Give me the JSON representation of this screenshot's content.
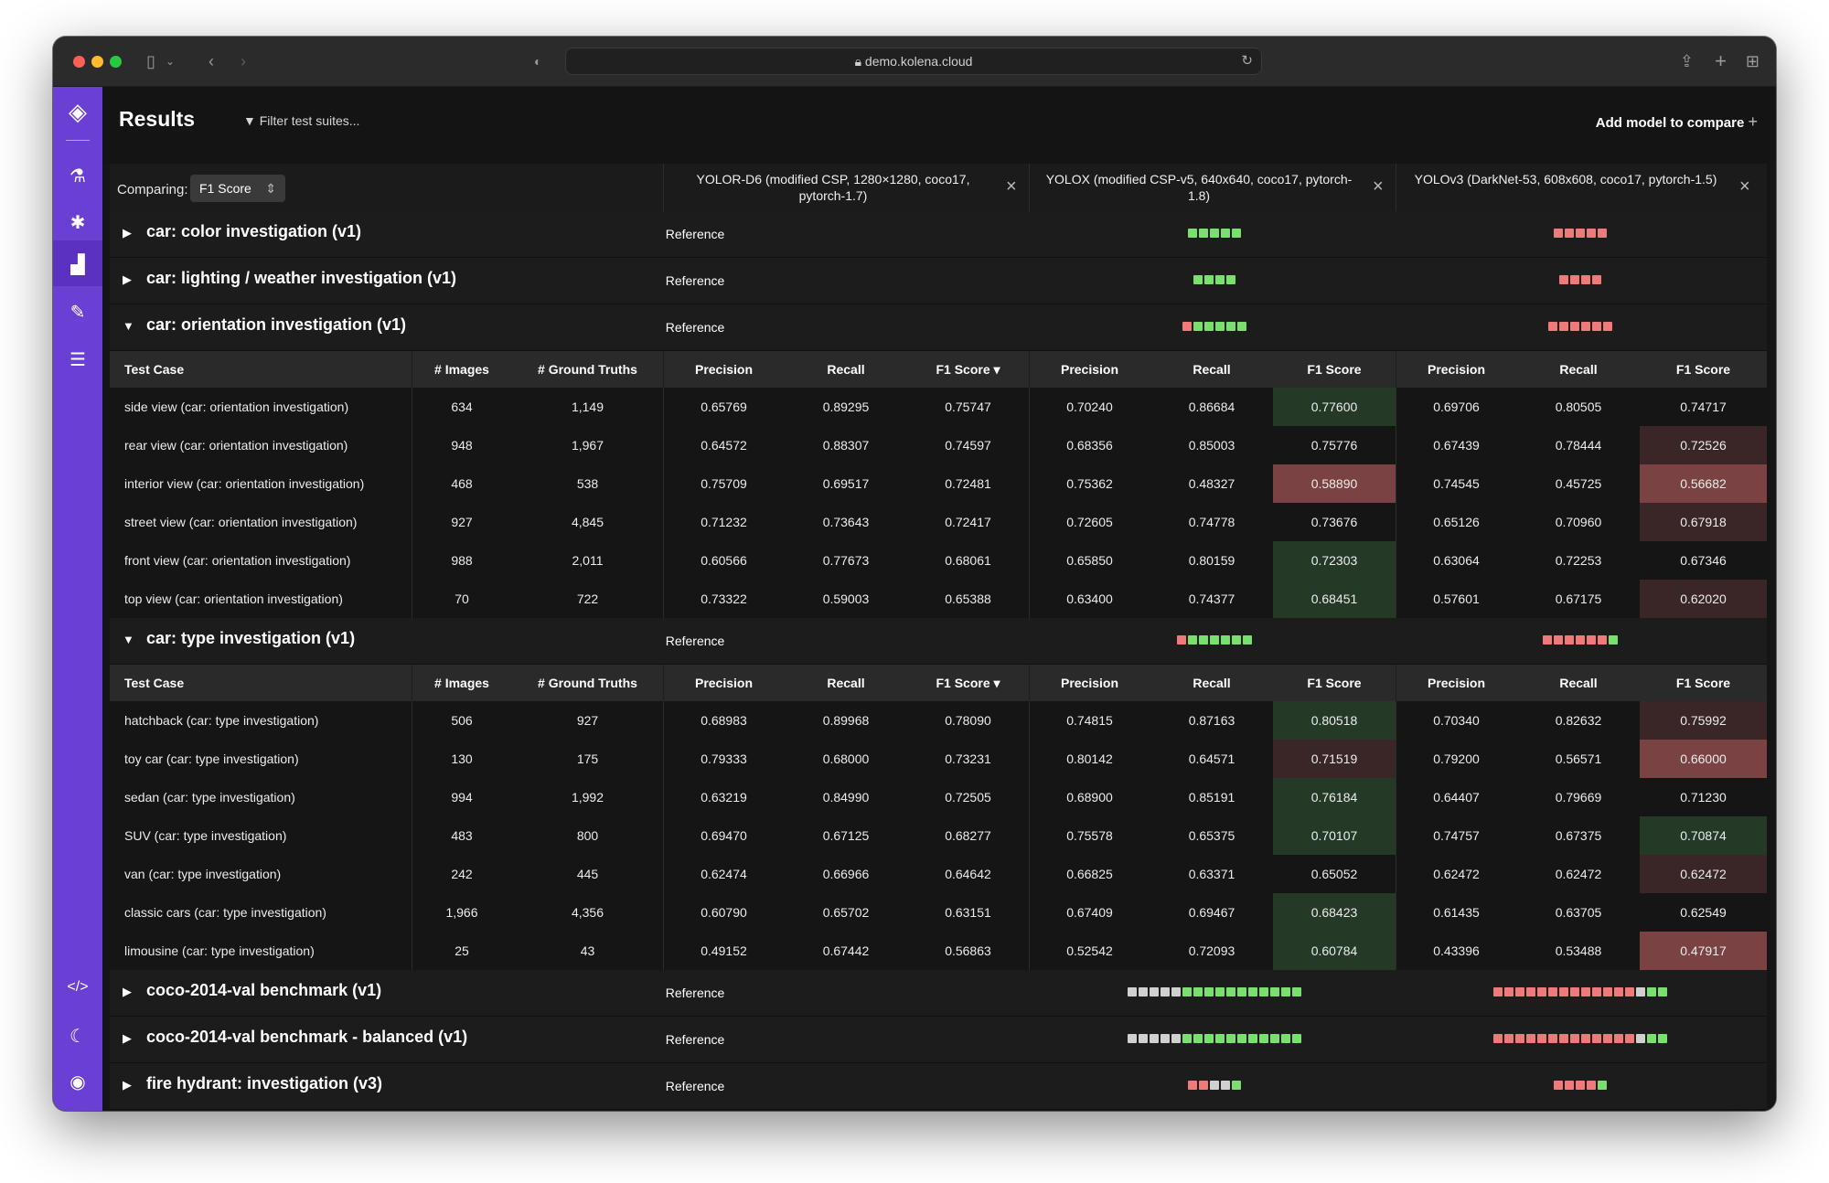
{
  "browser": {
    "url": "demo.kolena.cloud"
  },
  "app": {
    "title": "Results",
    "filter_label": "Filter test suites...",
    "add_model_label": "Add model to compare",
    "comparing_label": "Comparing:",
    "comparing_value": "F1 Score"
  },
  "models": [
    {
      "name": "YOLOR-D6 (modified CSP, 1280×1280, coco17, pytorch-1.7)"
    },
    {
      "name": "YOLOX (modified CSP-v5, 640x640, coco17, pytorch-1.8)"
    },
    {
      "name": "YOLOv3 (DarkNet-53, 608x608, coco17, pytorch-1.5)"
    }
  ],
  "columns": {
    "test_case": "Test Case",
    "images": "# Images",
    "ground_truths": "# Ground Truths",
    "precision": "Precision",
    "recall": "Recall",
    "f1": "F1 Score",
    "f1_sorted": "F1 Score ▾"
  },
  "reference_label": "Reference",
  "colors": {
    "green": "#79e06d",
    "red": "#f07a7a",
    "gray": "#d0d0d0",
    "cell_green": "#243a26",
    "cell_red": "#5a3232",
    "cell_red_strong": "#7a4242",
    "cell_dark_red": "#3a2626"
  },
  "suites": [
    {
      "name": "car: color investigation (v1)",
      "expanded": false,
      "m2": [
        "g",
        "g",
        "g",
        "g",
        "g"
      ],
      "m3": [
        "r",
        "r",
        "r",
        "r",
        "r"
      ]
    },
    {
      "name": "car: lighting / weather investigation (v1)",
      "expanded": false,
      "m2": [
        "g",
        "g",
        "g",
        "g"
      ],
      "m3": [
        "r",
        "r",
        "r",
        "r"
      ]
    },
    {
      "name": "car: orientation investigation (v1)",
      "expanded": true,
      "m2": [
        "r",
        "g",
        "g",
        "g",
        "g",
        "g"
      ],
      "m3": [
        "r",
        "r",
        "r",
        "r",
        "r",
        "r"
      ],
      "rows": [
        {
          "tc": "side view (car: orientation investigation)",
          "img": "634",
          "gt": "1,149",
          "v": [
            "0.65769",
            "0.89295",
            "0.75747",
            "0.70240",
            "0.86684",
            "0.77600",
            "0.69706",
            "0.80505",
            "0.74717"
          ],
          "c2": "green",
          "c3": "none"
        },
        {
          "tc": "rear view (car: orientation investigation)",
          "img": "948",
          "gt": "1,967",
          "v": [
            "0.64572",
            "0.88307",
            "0.74597",
            "0.68356",
            "0.85003",
            "0.75776",
            "0.67439",
            "0.78444",
            "0.72526"
          ],
          "c2": "none",
          "c3": "dred"
        },
        {
          "tc": "interior view (car: orientation investigation)",
          "img": "468",
          "gt": "538",
          "v": [
            "0.75709",
            "0.69517",
            "0.72481",
            "0.75362",
            "0.48327",
            "0.58890",
            "0.74545",
            "0.45725",
            "0.56682"
          ],
          "c2": "red",
          "c3": "red"
        },
        {
          "tc": "street view (car: orientation investigation)",
          "img": "927",
          "gt": "4,845",
          "v": [
            "0.71232",
            "0.73643",
            "0.72417",
            "0.72605",
            "0.74778",
            "0.73676",
            "0.65126",
            "0.70960",
            "0.67918"
          ],
          "c2": "none",
          "c3": "dred"
        },
        {
          "tc": "front view (car: orientation investigation)",
          "img": "988",
          "gt": "2,011",
          "v": [
            "0.60566",
            "0.77673",
            "0.68061",
            "0.65850",
            "0.80159",
            "0.72303",
            "0.63064",
            "0.72253",
            "0.67346"
          ],
          "c2": "green",
          "c3": "none"
        },
        {
          "tc": "top view (car: orientation investigation)",
          "img": "70",
          "gt": "722",
          "v": [
            "0.73322",
            "0.59003",
            "0.65388",
            "0.63400",
            "0.74377",
            "0.68451",
            "0.57601",
            "0.67175",
            "0.62020"
          ],
          "c2": "green",
          "c3": "dred"
        }
      ]
    },
    {
      "name": "car: type investigation (v1)",
      "expanded": true,
      "m2": [
        "r",
        "g",
        "g",
        "g",
        "g",
        "g",
        "g"
      ],
      "m3": [
        "r",
        "r",
        "r",
        "r",
        "r",
        "r",
        "g"
      ],
      "rows": [
        {
          "tc": "hatchback (car: type investigation)",
          "img": "506",
          "gt": "927",
          "v": [
            "0.68983",
            "0.89968",
            "0.78090",
            "0.74815",
            "0.87163",
            "0.80518",
            "0.70340",
            "0.82632",
            "0.75992"
          ],
          "c2": "green",
          "c3": "dred"
        },
        {
          "tc": "toy car (car: type investigation)",
          "img": "130",
          "gt": "175",
          "v": [
            "0.79333",
            "0.68000",
            "0.73231",
            "0.80142",
            "0.64571",
            "0.71519",
            "0.79200",
            "0.56571",
            "0.66000"
          ],
          "c2": "dred",
          "c3": "red"
        },
        {
          "tc": "sedan (car: type investigation)",
          "img": "994",
          "gt": "1,992",
          "v": [
            "0.63219",
            "0.84990",
            "0.72505",
            "0.68900",
            "0.85191",
            "0.76184",
            "0.64407",
            "0.79669",
            "0.71230"
          ],
          "c2": "green",
          "c3": "none"
        },
        {
          "tc": "SUV (car: type investigation)",
          "img": "483",
          "gt": "800",
          "v": [
            "0.69470",
            "0.67125",
            "0.68277",
            "0.75578",
            "0.65375",
            "0.70107",
            "0.74757",
            "0.67375",
            "0.70874"
          ],
          "c2": "green",
          "c3": "green"
        },
        {
          "tc": "van (car: type investigation)",
          "img": "242",
          "gt": "445",
          "v": [
            "0.62474",
            "0.66966",
            "0.64642",
            "0.66825",
            "0.63371",
            "0.65052",
            "0.62472",
            "0.62472",
            "0.62472"
          ],
          "c2": "none",
          "c3": "dred"
        },
        {
          "tc": "classic cars (car: type investigation)",
          "img": "1,966",
          "gt": "4,356",
          "v": [
            "0.60790",
            "0.65702",
            "0.63151",
            "0.67409",
            "0.69467",
            "0.68423",
            "0.61435",
            "0.63705",
            "0.62549"
          ],
          "c2": "green",
          "c3": "none"
        },
        {
          "tc": "limousine (car: type investigation)",
          "img": "25",
          "gt": "43",
          "v": [
            "0.49152",
            "0.67442",
            "0.56863",
            "0.52542",
            "0.72093",
            "0.60784",
            "0.43396",
            "0.53488",
            "0.47917"
          ],
          "c2": "green",
          "c3": "red"
        }
      ]
    },
    {
      "name": "coco-2014-val benchmark (v1)",
      "expanded": false,
      "m2": [
        "w",
        "w",
        "w",
        "w",
        "w",
        "g",
        "g",
        "g",
        "g",
        "g",
        "g",
        "g",
        "g",
        "g",
        "g",
        "g"
      ],
      "m3": [
        "r",
        "r",
        "r",
        "r",
        "r",
        "r",
        "r",
        "r",
        "r",
        "r",
        "r",
        "r",
        "r",
        "w",
        "g",
        "g"
      ]
    },
    {
      "name": "coco-2014-val benchmark - balanced (v1)",
      "expanded": false,
      "m2": [
        "w",
        "w",
        "w",
        "w",
        "w",
        "g",
        "g",
        "g",
        "g",
        "g",
        "g",
        "g",
        "g",
        "g",
        "g",
        "g"
      ],
      "m3": [
        "r",
        "r",
        "r",
        "r",
        "r",
        "r",
        "r",
        "r",
        "r",
        "r",
        "r",
        "r",
        "r",
        "w",
        "g",
        "g"
      ]
    },
    {
      "name": "fire hydrant: investigation (v3)",
      "expanded": false,
      "m2": [
        "r",
        "r",
        "w",
        "w",
        "g"
      ],
      "m3": [
        "r",
        "r",
        "r",
        "r",
        "g"
      ]
    }
  ]
}
